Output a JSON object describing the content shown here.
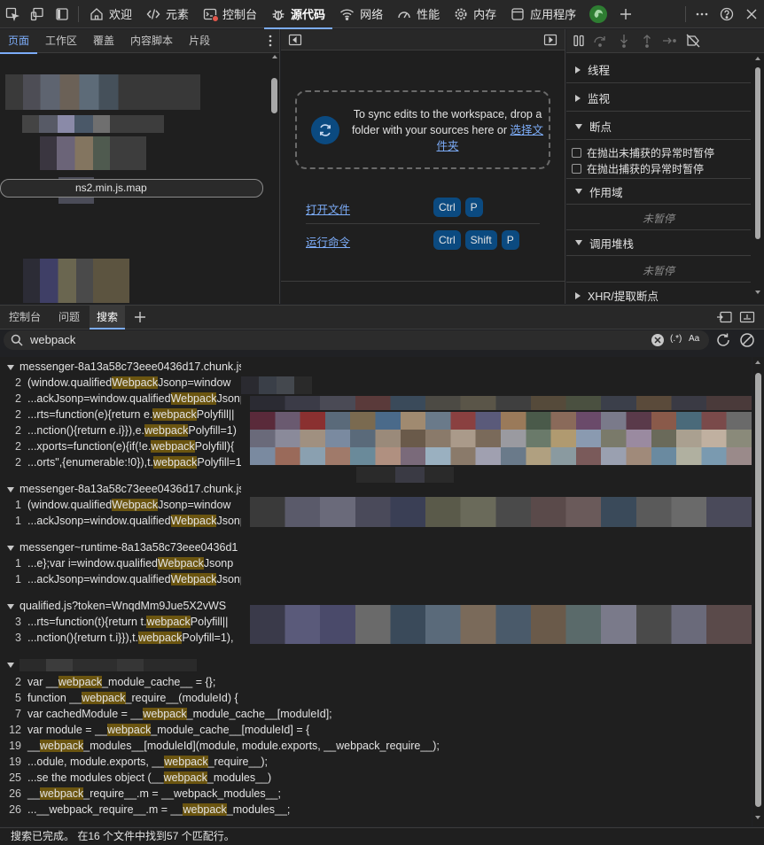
{
  "topbar": {
    "tabs": [
      {
        "label": "欢迎",
        "icon": "home-icon"
      },
      {
        "label": "元素",
        "icon": "code-icon"
      },
      {
        "label": "控制台",
        "icon": "console-icon"
      },
      {
        "label": "源代码",
        "icon": "bug-icon"
      },
      {
        "label": "网络",
        "icon": "wifi-icon"
      },
      {
        "label": "性能",
        "icon": "gauge-icon"
      },
      {
        "label": "内存",
        "icon": "gear-icon"
      },
      {
        "label": "应用程序",
        "icon": "app-icon"
      }
    ],
    "active_tab": "源代码"
  },
  "left": {
    "tabs": [
      "页面",
      "工作区",
      "覆盖",
      "内容脚本",
      "片段"
    ],
    "file_pill": "ns2.min.js.map"
  },
  "center": {
    "sync_text": "To sync edits to the workspace, drop a folder with your sources here or",
    "sync_link": "选择文件夹",
    "commands": [
      {
        "label": "打开文件",
        "keys": [
          "Ctrl",
          "P"
        ]
      },
      {
        "label": "运行命令",
        "keys": [
          "Ctrl",
          "Shift",
          "P"
        ]
      }
    ]
  },
  "debugger": {
    "threads": "线程",
    "watch": "监视",
    "breakpoints": "断点",
    "pause_uncaught": "在抛出未捕获的异常时暂停",
    "pause_caught": "在抛出捕获的异常时暂停",
    "scope": "作用域",
    "not_paused": "未暂停",
    "call_stack": "调用堆栈",
    "not_paused2": "未暂停",
    "xhr": "XHR/提取断点"
  },
  "drawer": {
    "tabs": [
      "控制台",
      "问题",
      "搜索"
    ],
    "active": "搜索"
  },
  "search": {
    "query": "webpack",
    "regex_label": "(.*)",
    "case_label": "Aa"
  },
  "results": {
    "file1": "messenger-8a13a58c73eee0436d17.chunk.js",
    "file2": "messenger-8a13a58c73eee0436d17.chunk.js",
    "file3": "messenger~runtime-8a13a58c73eee0436d1",
    "file4": "qualified.js?token=WnqdMm9Jue5X2vWS",
    "f1": [
      {
        "n": "2",
        "pre": "(window.qualified",
        "hit": "Webpack",
        "post": "Jsonp=window"
      },
      {
        "n": "2",
        "pre": "...ackJsonp=window.qualified",
        "hit": "Webpack",
        "post": "Jsonp"
      },
      {
        "n": "2",
        "pre": "...rts=function(e){return e.",
        "hit": "webpack",
        "post": "Polyfill||"
      },
      {
        "n": "2",
        "pre": "...nction(){return e.i}}),e.",
        "hit": "webpack",
        "post": "Polyfill=1)"
      },
      {
        "n": "2",
        "pre": "...xports=function(e){if(!e.",
        "hit": "webpack",
        "post": "Polyfill){"
      },
      {
        "n": "2",
        "pre": "...orts\",{enumerable:!0}),t.",
        "hit": "webpack",
        "post": "Polyfill=1"
      }
    ],
    "f2": [
      {
        "n": "1",
        "pre": "(window.qualified",
        "hit": "Webpack",
        "post": "Jsonp=window"
      },
      {
        "n": "1",
        "pre": "...ackJsonp=window.qualified",
        "hit": "Webpack",
        "post": "Jsonp"
      }
    ],
    "f3": [
      {
        "n": "1",
        "pre": "...e};var i=window.qualified",
        "hit": "Webpack",
        "post": "Jsonp"
      },
      {
        "n": "1",
        "pre": "...ackJsonp=window.qualified",
        "hit": "Webpack",
        "post": "Jsonp"
      }
    ],
    "f4": [
      {
        "n": "3",
        "pre": "...rts=function(t){return t.",
        "hit": "webpack",
        "post": "Polyfill||"
      },
      {
        "n": "3",
        "pre": "...nction(){return t.i}}),t.",
        "hit": "webpack",
        "post": "Polyfill=1),"
      }
    ],
    "f5": [
      {
        "n": "2",
        "pre": "var __",
        "hit": "webpack",
        "post": "_module_cache__ = {};"
      },
      {
        "n": "5",
        "pre": "function __",
        "hit": "webpack",
        "post": "_require__(moduleId) {"
      },
      {
        "n": "7",
        "pre": "var cachedModule = __",
        "hit": "webpack",
        "post": "_module_cache__[moduleId];"
      },
      {
        "n": "12",
        "pre": " var module = __",
        "hit": "webpack",
        "post": "_module_cache__[moduleId] = {"
      },
      {
        "n": "19",
        "pre": " __",
        "hit": "webpack",
        "post": "_modules__[moduleId](module, module.exports, __webpack_require__);"
      },
      {
        "n": "19",
        "pre": " ...odule, module.exports, __",
        "hit": "webpack",
        "post": "_require__);"
      },
      {
        "n": "25",
        "pre": " ...se the modules object (__",
        "hit": "webpack",
        "post": "_modules__)"
      },
      {
        "n": "26",
        "pre": " __",
        "hit": "webpack",
        "post": "_require__.m = __webpack_modules__;"
      },
      {
        "n": "26",
        "pre": " ...__webpack_require__.m = __",
        "hit": "webpack",
        "post": "_modules__;"
      }
    ]
  },
  "status": "搜索已完成。 在16 个文件中找到57 个匹配行。",
  "colors": {
    "accent": "#7cacf8",
    "highlight": "#6b5510",
    "key_bg": "#0b4a80"
  }
}
